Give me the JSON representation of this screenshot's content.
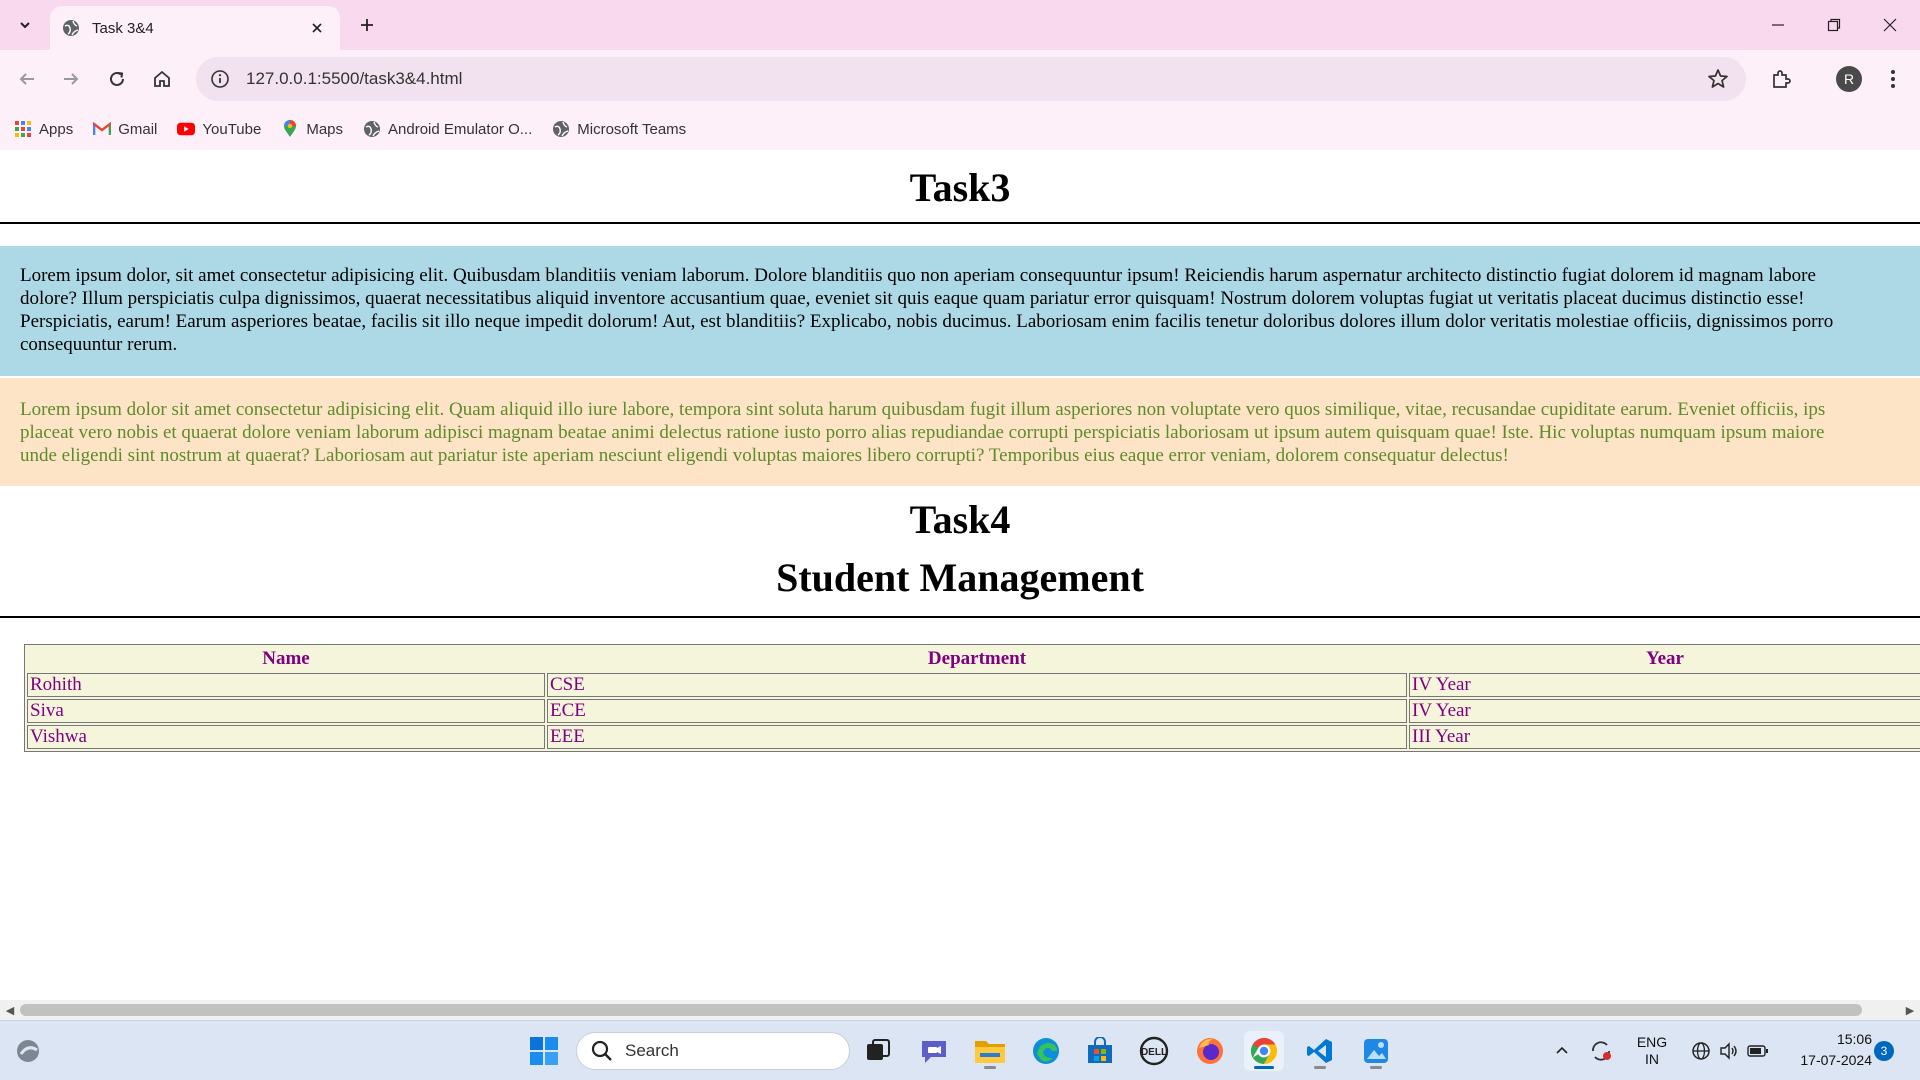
{
  "browser": {
    "tab_title": "Task 3&4",
    "url": "127.0.0.1:5500/task3&4.html",
    "profile_initial": "R",
    "bookmarks": [
      {
        "label": "Apps",
        "icon": "apps-grid-icon"
      },
      {
        "label": "Gmail",
        "icon": "gmail-icon"
      },
      {
        "label": "YouTube",
        "icon": "youtube-icon"
      },
      {
        "label": "Maps",
        "icon": "maps-icon"
      },
      {
        "label": "Android Emulator O...",
        "icon": "globe-icon"
      },
      {
        "label": "Microsoft Teams",
        "icon": "globe-icon"
      }
    ]
  },
  "page": {
    "task3_heading": "Task3",
    "para1": [
      "Lorem ipsum dolor, sit amet consectetur adipisicing elit. Quibusdam blanditiis veniam laborum. Dolore blanditiis quo non aperiam consequuntur ipsum! Reiciendis harum aspernatur architecto distinctio fugiat dolorem id magnam labore",
      "dolore? Illum perspiciatis culpa dignissimos, quaerat necessitatibus aliquid inventore accusantium quae, eveniet sit quis eaque quam pariatur error quisquam! Nostrum dolorem voluptas fugiat ut veritatis placeat ducimus distinctio esse!",
      "Perspiciatis, earum! Earum asperiores beatae, facilis sit illo neque impedit dolorum! Aut, est blanditiis? Explicabo, nobis ducimus. Laboriosam enim facilis tenetur doloribus dolores illum dolor veritatis molestiae officiis, dignissimos porro",
      "consequuntur rerum."
    ],
    "para2": [
      "Lorem ipsum dolor sit amet consectetur adipisicing elit. Quam aliquid illo iure labore, tempora sint soluta harum quibusdam fugit illum asperiores non voluptate vero quos similique, vitae, recusandae cupiditate earum. Eveniet officiis, ips",
      "placeat vero nobis et quaerat dolore veniam laborum adipisci magnam beatae animi delectus ratione iusto porro alias repudiandae corrupti perspiciatis laboriosam ut ipsum autem quisquam quae! Iste. Hic voluptas numquam ipsum maiore",
      "unde eligendi sint nostrum at quaerat? Laboriosam aut pariatur iste aperiam nesciunt eligendi voluptas maiores libero corrupti? Temporibus eius eaque error veniam, dolorem consequatur delectus!"
    ],
    "task4_heading": "Task4",
    "student_heading": "Student Management",
    "table": {
      "headers": [
        "Name",
        "Department",
        "Year"
      ],
      "rows": [
        [
          "Rohith",
          "CSE",
          "IV Year"
        ],
        [
          "Siva",
          "ECE",
          "IV Year"
        ],
        [
          "Vishwa",
          "EEE",
          "III Year"
        ]
      ]
    },
    "colors": {
      "para1_bg": "#add8e6",
      "para2_bg": "#fde4c7",
      "para2_text": "#5f8a2a",
      "table_bg": "#f5f5dc",
      "table_text": "#800080"
    }
  },
  "taskbar": {
    "search_placeholder": "Search",
    "language_line1": "ENG",
    "language_line2": "IN",
    "time": "15:06",
    "date": "17-07-2024",
    "notification_count": "3"
  }
}
